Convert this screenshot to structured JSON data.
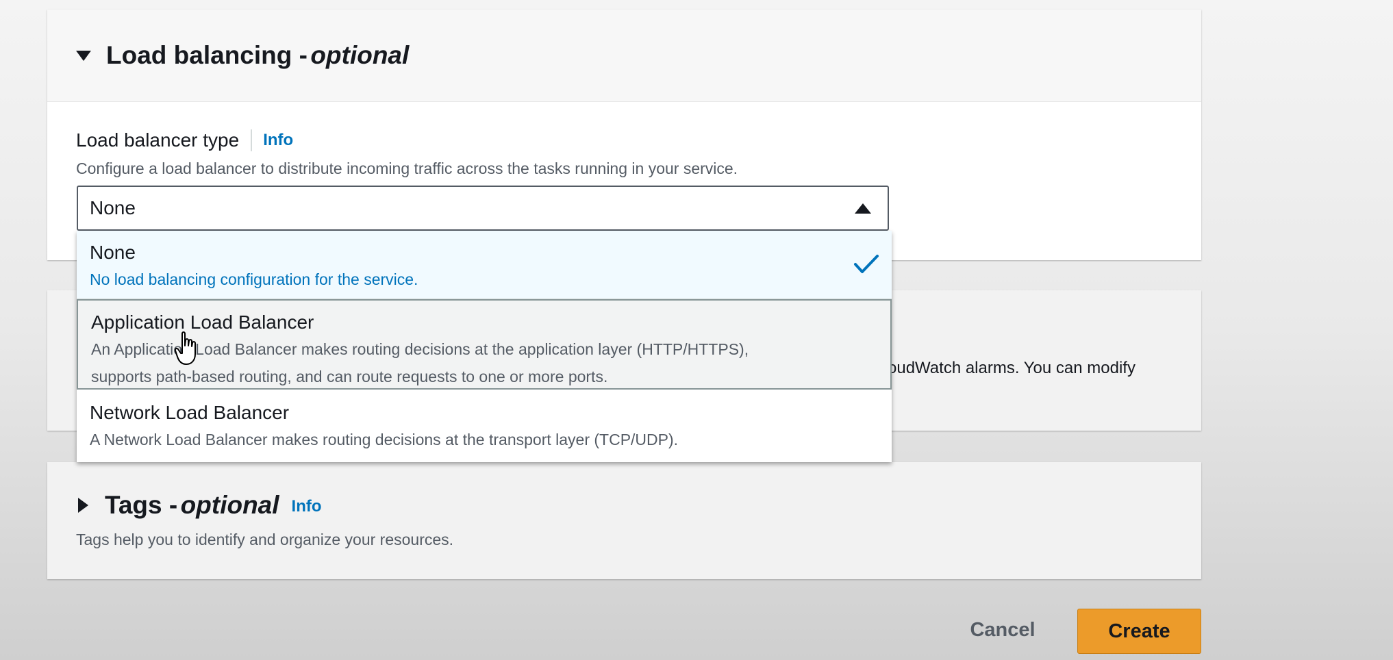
{
  "load_balancing": {
    "title": "Load balancing -",
    "optional": "optional",
    "field_label": "Load balancer type",
    "info": "Info",
    "description": "Configure a load balancer to distribute incoming traffic across the tasks running in your service.",
    "selected_value": "None",
    "options": [
      {
        "label": "None",
        "description": "No load balancing configuration for the service.",
        "selected": true
      },
      {
        "label": "Application Load Balancer",
        "description_line1": "An Application Load Balancer makes routing decisions at the application layer (HTTP/HTTPS),",
        "description_line2": "supports path-based routing, and can route requests to one or more ports."
      },
      {
        "label": "Network Load Balancer",
        "description": "A Network Load Balancer makes routing decisions at the transport layer (TCP/UDP)."
      }
    ]
  },
  "obscured_section": {
    "visible_text": "oudWatch alarms. You can modify"
  },
  "tags": {
    "title": "Tags -",
    "optional": "optional",
    "info": "Info",
    "description": "Tags help you to identify and organize your resources."
  },
  "actions": {
    "cancel": "Cancel",
    "create": "Create"
  },
  "colors": {
    "link": "#0073bb",
    "primary_button": "#ec9b2a",
    "selected_option_bg": "#f1faff"
  }
}
